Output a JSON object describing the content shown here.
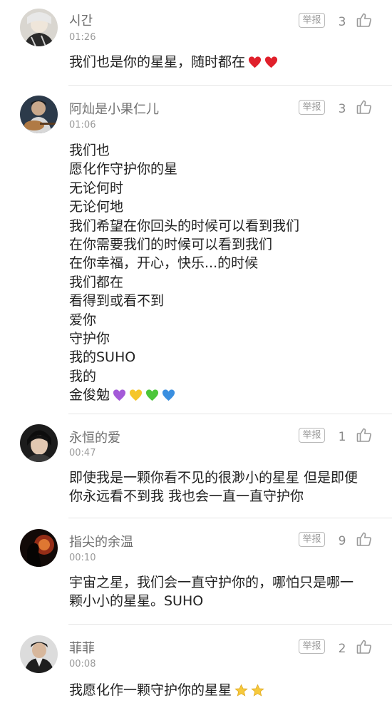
{
  "report_label": "举报",
  "comments": [
    {
      "username": "시간",
      "time": "01:26",
      "likes": "3",
      "lines": [
        "我们也是你的星星，随时都在"
      ],
      "emoji": [
        "heart-icon",
        "heart-icon"
      ]
    },
    {
      "username": "阿灿是小果仁儿",
      "time": "01:06",
      "likes": "3",
      "lines": [
        "我们也",
        "愿化作守护你的星",
        "无论何时",
        "无论何地",
        "我们希望在你回头的时候可以看到我们",
        "在你需要我们的时候可以看到我们",
        "在你幸福，开心，快乐...的时候",
        "我们都在",
        "看得到或看不到",
        "爱你",
        "守护你",
        "我的SUHO",
        "我的",
        "金俊勉"
      ],
      "emoji": [
        "purple-heart-icon",
        "yellow-heart-icon",
        "green-heart-icon",
        "blue-heart-icon"
      ]
    },
    {
      "username": "永恒的爱",
      "time": "00:47",
      "likes": "1",
      "lines": [
        "即使我是一颗你看不见的很渺小的星星 但是即便",
        "你永远看不到我 我也会一直一直守护你"
      ],
      "emoji": []
    },
    {
      "username": "指尖的余温",
      "time": "00:10",
      "likes": "9",
      "lines": [
        "宇宙之星，我们会一直守护你的，哪怕只是哪一",
        "颗小小的星星。SUHO"
      ],
      "emoji": []
    },
    {
      "username": "菲菲",
      "time": "00:08",
      "likes": "2",
      "lines": [
        "我愿化作一颗守护你的星星"
      ],
      "emoji": [
        "star-icon",
        "star-icon"
      ]
    }
  ],
  "colors": {
    "heart": "#e0202b",
    "purple_heart": "#a45ad8",
    "yellow_heart": "#f5c62a",
    "green_heart": "#4cc63a",
    "blue_heart": "#3a8fe0",
    "star": "#f6c93c"
  }
}
